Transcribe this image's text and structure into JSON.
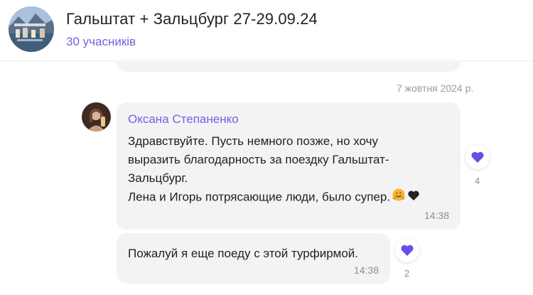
{
  "header": {
    "title": "Гальштат + Зальцбург 27-29.09.24",
    "members": "30 учасників"
  },
  "feed": {
    "date": "7 жовтня 2024 р.",
    "messages": [
      {
        "sender": "Оксана Степаненко",
        "lines": [
          "Здравствуйте. Пусть немного позже, но хочу",
          "выразить благодарность за поездку Гальштат-",
          "Зальцбург.",
          "Лена и Игорь потрясающие люди, было супер."
        ],
        "emojis": [
          "hugging-face",
          "heart"
        ],
        "time": "14:38",
        "reaction_count": "4"
      },
      {
        "lines": [
          "Пожалуй я еще поеду с этой турфирмой."
        ],
        "time": "14:38",
        "reaction_count": "2"
      }
    ]
  },
  "colors": {
    "accent": "#7b5ee0",
    "bubble": "#f3f3f5",
    "heart_reaction": "#6a4ee6"
  }
}
